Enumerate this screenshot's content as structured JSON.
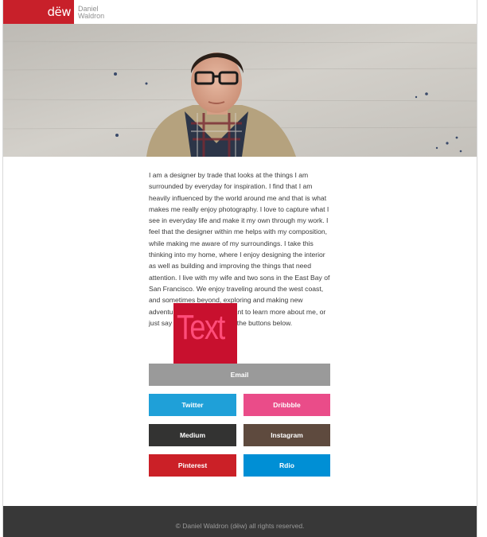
{
  "header": {
    "logo_text": "dëw",
    "name_first": "Daniel",
    "name_last": "Waldron"
  },
  "hero": {
    "alt": "Portrait photo of a man with glasses in a plaid shirt and jacket"
  },
  "bio": {
    "text": "I am a designer by trade that looks at the things I am surrounded by everyday for inspiration. I find that I am heavily influenced by the world around me and that is what makes me really enjoy photography. I love to capture what I see in everyday life and make it my own through my work. I feel that the designer within me helps with my composition, while making me aware of my surroundings. I take this thinking into my home, where I enjoy designing the interior as well as building and improving the things that need attention. I live with my wife and two sons in the East Bay of San Francisco. We enjoy traveling around the west coast, and sometimes beyond, exploring and making new adventures for ourselves. Want to learn more about me, or just say hello? Click some of the buttons below."
  },
  "overlay": {
    "label": "Text"
  },
  "buttons": {
    "email": "Email",
    "twitter": "Twitter",
    "dribbble": "Dribbble",
    "medium": "Medium",
    "instagram": "Instagram",
    "pinterest": "Pinterest",
    "rdio": "Rdio"
  },
  "footer": {
    "copyright": "© Daniel Waldron (dëw) all rights reserved."
  },
  "colors": {
    "brand_red": "#c8202a",
    "email": "#9a9a9a",
    "twitter": "#1fa0d8",
    "dribbble": "#ea4c89",
    "medium": "#333332",
    "instagram": "#5e4a3e",
    "pinterest": "#cb2027",
    "rdio": "#008fd5",
    "footer": "#383838"
  }
}
